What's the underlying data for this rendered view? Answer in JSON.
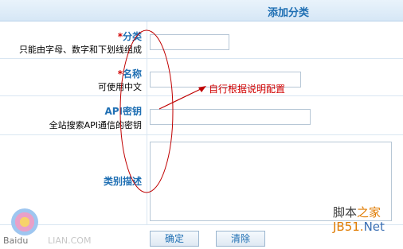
{
  "header": {
    "title": "添加分类"
  },
  "form": {
    "category": {
      "required_mark": "*",
      "label": "分类",
      "hint": "只能由字母、数字和下划线组成",
      "value": ""
    },
    "name": {
      "required_mark": "*",
      "label": "名称",
      "hint": "可使用中文",
      "value": ""
    },
    "api_key": {
      "label": "API密钥",
      "hint": "全站搜索API通信的密钥",
      "value": ""
    },
    "description": {
      "label": "类别描述",
      "value": ""
    }
  },
  "buttons": {
    "confirm": "确定",
    "clear": "清除"
  },
  "annotation": {
    "text": "自行根据说明配置"
  },
  "watermark": {
    "site_part1": "脚本",
    "site_part2": "之家",
    "domain_part1": "JB51.",
    "domain_part2": "Net",
    "left": "Baidu",
    "left2": "LIAN.COM"
  },
  "colors": {
    "accent": "#1f6fb3",
    "required": "#d10000",
    "annotation": "#d10000"
  }
}
